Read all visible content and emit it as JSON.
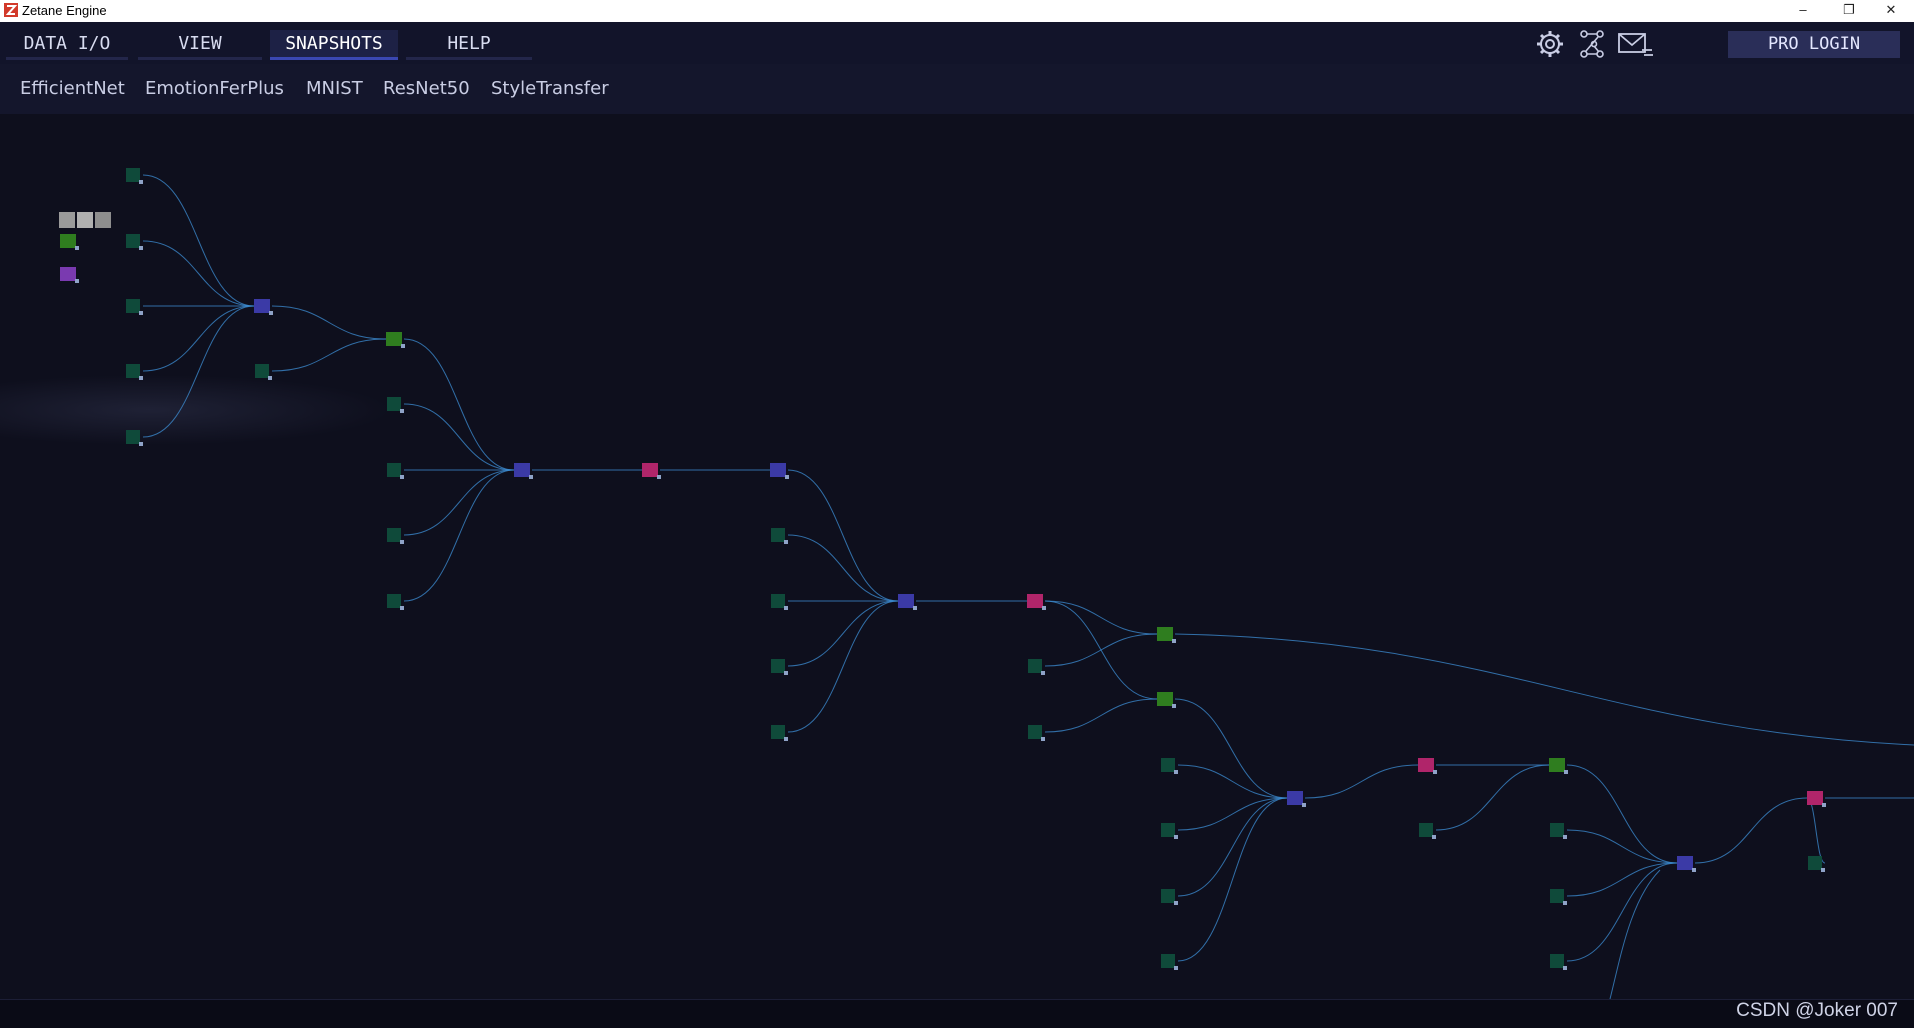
{
  "window": {
    "title": "Zetane Engine",
    "controls": {
      "minimize": "–",
      "maximize": "❐",
      "close": "✕"
    },
    "app_icon": "zetane-logo-icon"
  },
  "menu": {
    "tabs": [
      {
        "label": "DATA I/O",
        "active": false
      },
      {
        "label": "VIEW",
        "active": false
      },
      {
        "label": "SNAPSHOTS",
        "active": true
      },
      {
        "label": "HELP",
        "active": false
      }
    ],
    "tool_icons": [
      "gear-icon",
      "network-graph-icon",
      "mail-icon"
    ],
    "pro_login": "PRO LOGIN"
  },
  "snapshots": {
    "items": [
      "EfficientNet",
      "EmotionFerPlus",
      "MNIST",
      "ResNet50",
      "StyleTransfer"
    ]
  },
  "colors": {
    "background": "#0e0f1d",
    "node_input": "#0f4a3a",
    "node_conv": "#3b3aa6",
    "node_mul": "#b0256a",
    "node_green": "#2f7d1f",
    "node_purple": "#7a3ab0",
    "edge": "#3d8fd6"
  },
  "watermark": "CSDN @Joker 007"
}
